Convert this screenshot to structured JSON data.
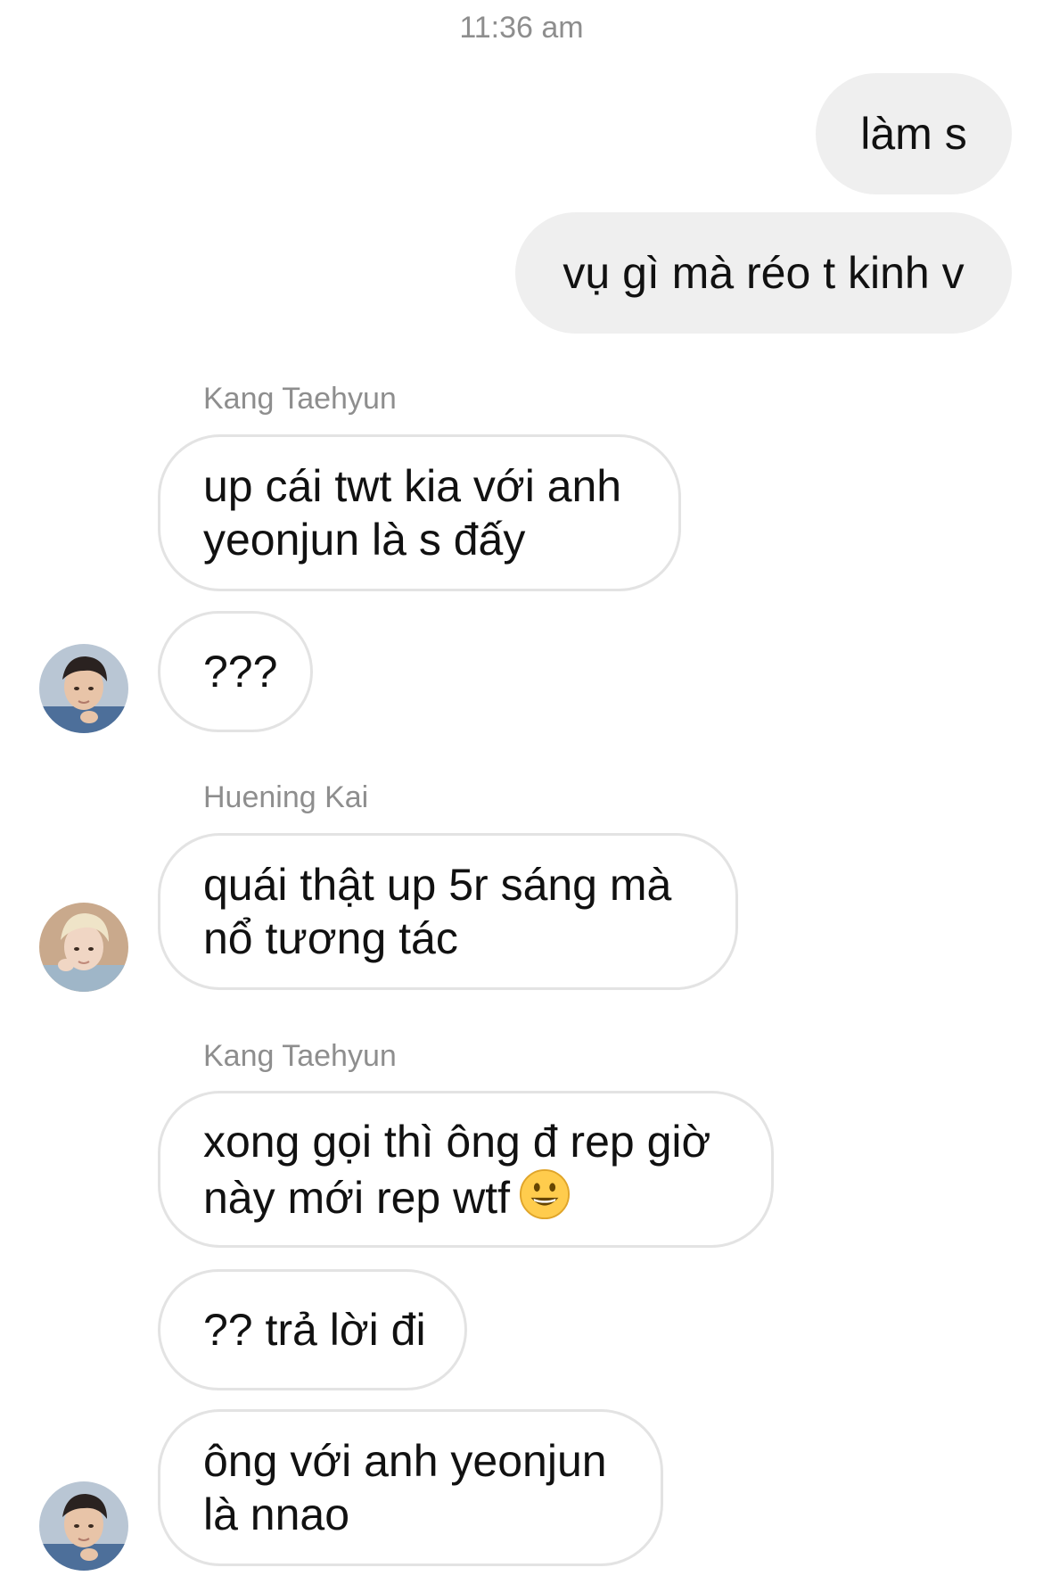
{
  "timestamp": "11:36 am",
  "outgoing": [
    "làm s",
    "vụ gì mà réo t kinh v"
  ],
  "groups": [
    {
      "sender": "Kang Taehyun",
      "messages": [
        "up cái twt kia với anh\nyeonjun là s đấy",
        "???"
      ],
      "avatar": "taehyun-avatar"
    },
    {
      "sender": "Huening Kai",
      "messages": [
        "quái thật up 5r sáng mà\nnổ tương tác"
      ],
      "avatar": "hueningkai-avatar"
    },
    {
      "sender": "Kang Taehyun",
      "messages": [
        "xong gọi thì ông đ rep giờ\nnày mới rep wtf",
        "?? trả lời đi",
        "ông với anh yeonjun\nlà nnao"
      ],
      "emoji": "grinning-face-icon",
      "avatar": "taehyun-avatar"
    }
  ],
  "colors": {
    "outgoing_bubble": "#efefef",
    "incoming_border": "#e3e3e3",
    "meta_text": "#8e8e8e"
  }
}
